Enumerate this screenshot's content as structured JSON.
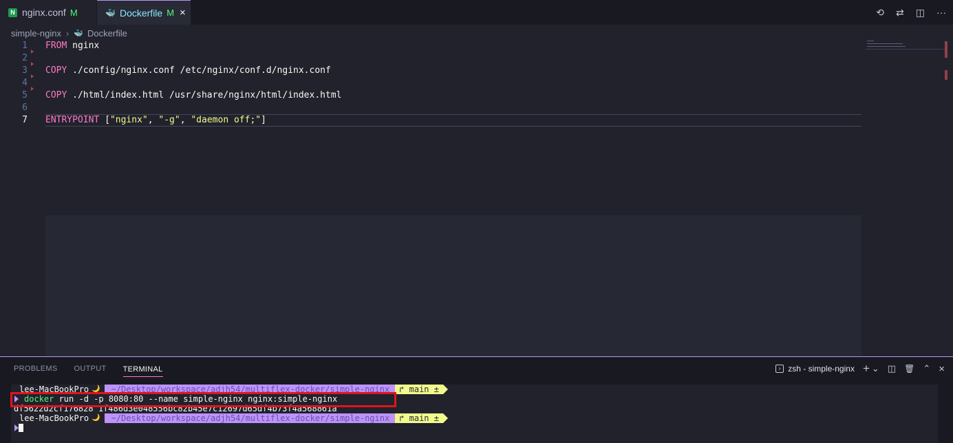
{
  "tabs": [
    {
      "label": "nginx.conf",
      "status": "M",
      "icon": "nginx-icon",
      "icon_letter": "N"
    },
    {
      "label": "Dockerfile",
      "status": "M",
      "icon": "docker-icon",
      "close": "×"
    }
  ],
  "toolbar": {
    "history": "⟲",
    "compare": "⇄",
    "split": "◫",
    "more": "···"
  },
  "breadcrumb": {
    "folder": "simple-nginx",
    "file": "Dockerfile",
    "separator": "›"
  },
  "editor": {
    "line_numbers": [
      "1",
      "2",
      "3",
      "4",
      "5",
      "6",
      "7"
    ],
    "lines": [
      {
        "kw": "FROM",
        "rest": " nginx"
      },
      {
        "kw": "",
        "rest": ""
      },
      {
        "kw": "COPY",
        "rest": " ./config/nginx.conf /etc/nginx/conf.d/nginx.conf"
      },
      {
        "kw": "",
        "rest": ""
      },
      {
        "kw": "COPY",
        "rest": " ./html/index.html /usr/share/nginx/html/index.html"
      },
      {
        "kw": "",
        "rest": ""
      },
      {
        "kw": "ENTRYPOINT",
        "p1": " [",
        "s1": "\"nginx\"",
        "c1": ", ",
        "s2": "\"-g\"",
        "c2": ", ",
        "s3": "\"daemon off;\"",
        "p2": "]"
      }
    ]
  },
  "panel": {
    "tabs": [
      "PROBLEMS",
      "OUTPUT",
      "TERMINAL"
    ],
    "terminal_name": "zsh - simple-nginx",
    "actions": {
      "add": "+",
      "dropdown": "⌄",
      "split": "◫",
      "trash": "🗑",
      "maximize": "⌃",
      "close": "×"
    }
  },
  "terminal": {
    "host": "lee-MacBookPro",
    "moon": "🌙",
    "path": "~/Desktop/workspace/adjh54/multiflex-docker/simple-nginx",
    "branch": "↱ main ±",
    "command_bin": "docker",
    "command_args": " run -d -p 8080:80 --name simple-nginx nginx:simple-nginx",
    "output": "df5622d2cf176828 1f486d3e048556bc82b45e7c12697d65df4b73f4a568861a"
  },
  "colors": {
    "accent": "#bd93f9",
    "highlight": "#e0141e"
  }
}
